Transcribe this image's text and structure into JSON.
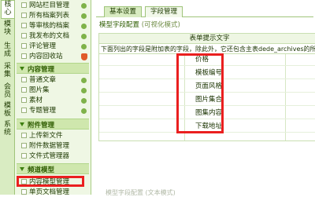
{
  "vtabs": [
    "核心",
    "模块",
    "生成",
    "采集",
    "会员",
    "模板",
    "系统"
  ],
  "menu": {
    "items_top": [
      {
        "label": "网站栏目管理",
        "badge": "plus"
      },
      {
        "label": "所有档案列表",
        "badge": "plus"
      },
      {
        "label": "等审核的档案",
        "badge": "plus"
      },
      {
        "label": "我发布的文档",
        "badge": "plus"
      },
      {
        "label": "评论管理",
        "badge": "plus"
      },
      {
        "label": "内容回收站",
        "badge": "shield"
      }
    ],
    "section_content": "内容管理",
    "items_content": [
      {
        "label": "普通文章",
        "badge": "plus"
      },
      {
        "label": "图片集",
        "badge": "plus"
      },
      {
        "label": "素材",
        "badge": "plus"
      },
      {
        "label": "专题管理",
        "badge": "plus"
      }
    ],
    "section_attach": "附件管理",
    "items_attach": [
      {
        "label": "上传新文件"
      },
      {
        "label": "附件数据管理"
      },
      {
        "label": "文件式管理器"
      }
    ],
    "section_channel": "频道模型",
    "items_channel": [
      {
        "label": "内容模型管理"
      },
      {
        "label": "单页文档管理"
      }
    ]
  },
  "main": {
    "tabs": [
      "基本设置",
      "字段管理"
    ],
    "section_title": "模型字段配置",
    "section_hint": "(可视化模式)",
    "table_header": "表单提示文字",
    "table_note": "下面列出的字段是附加表的字段，除此外，它还包含主表dede_archives的所有字段",
    "fields": [
      "价格",
      "模板编号",
      "页面风格",
      "图片集合",
      "图集内容",
      "下载地址"
    ],
    "bottom_text": "模型字段配置 (文本模式)"
  },
  "colors": {
    "highlight": "#ea1f1f",
    "sidebar_bg": "#eff7e4",
    "section_bg": "#cfe7ad"
  }
}
